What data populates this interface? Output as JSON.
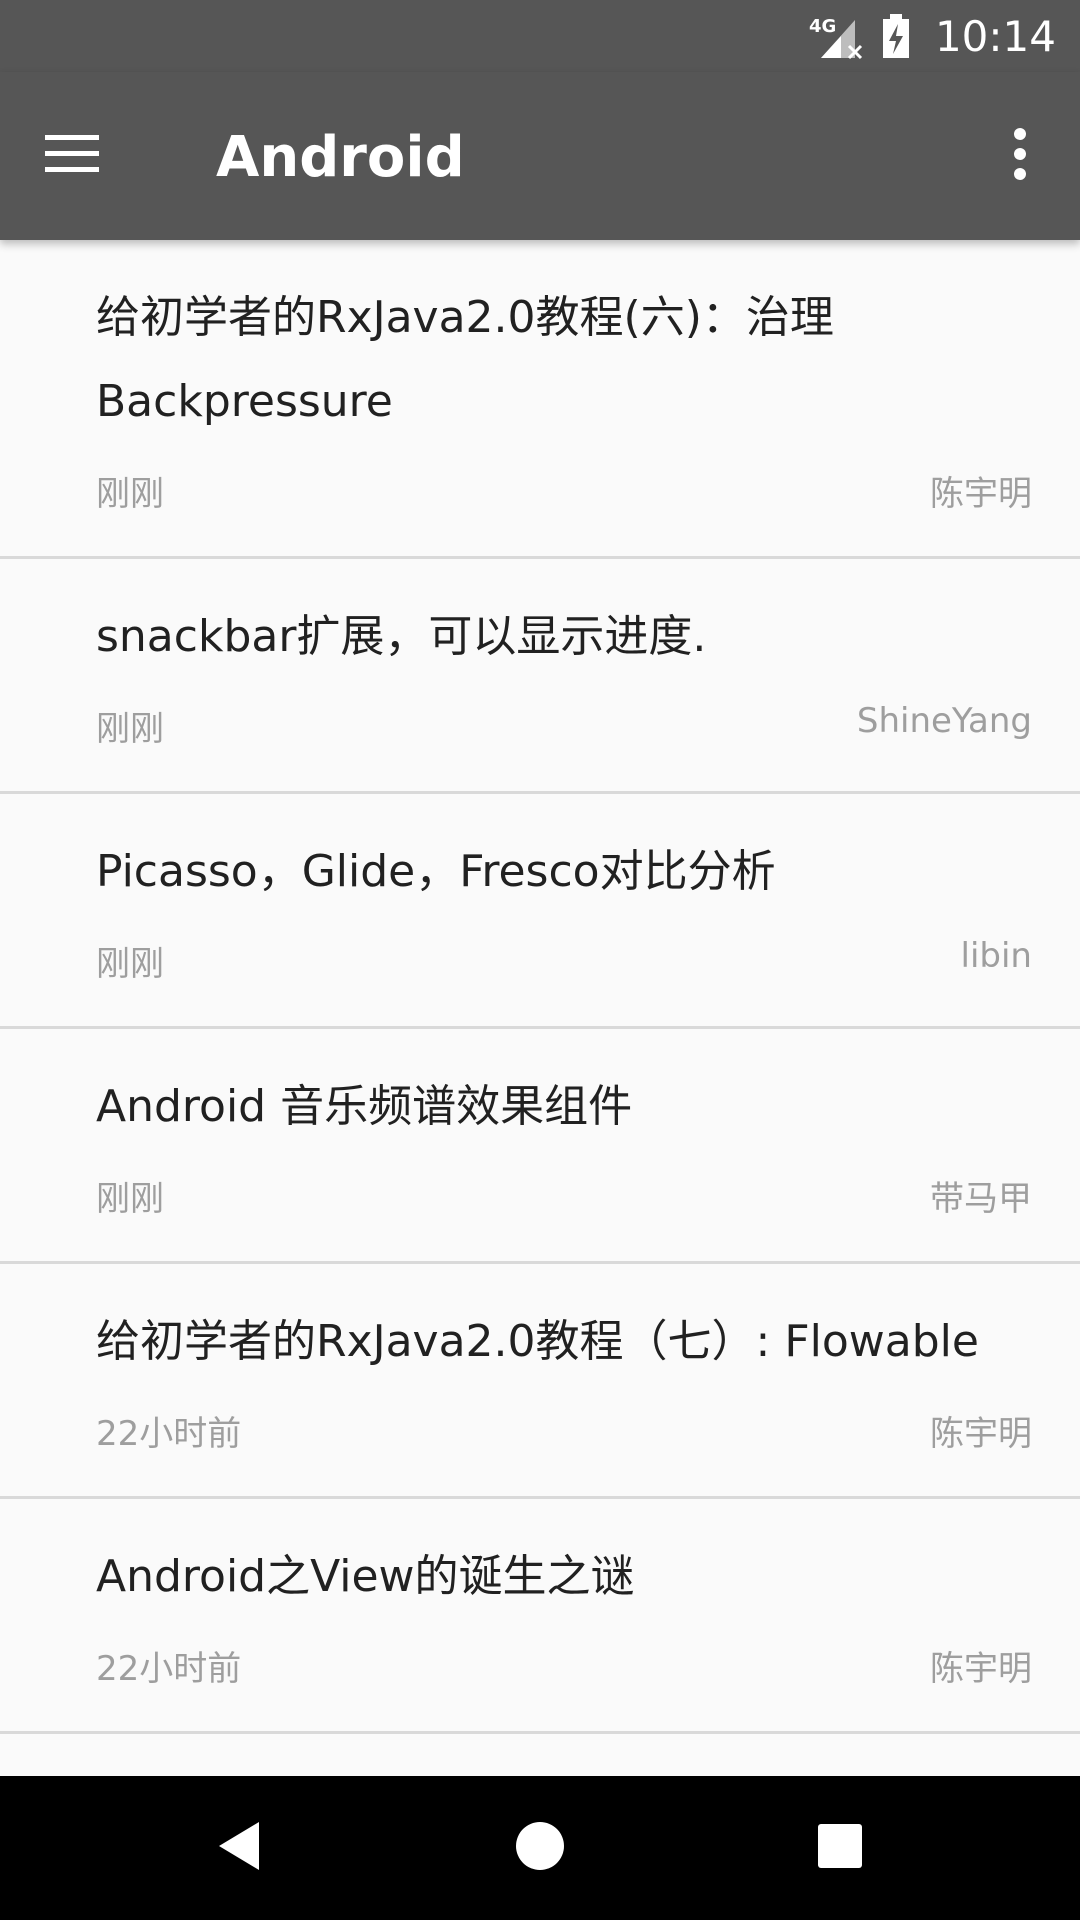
{
  "status_bar": {
    "network": "4G",
    "time": "10:14"
  },
  "app_bar": {
    "title": "Android"
  },
  "articles": [
    {
      "title": "给初学者的RxJava2.0教程(六)：治理Backpressure",
      "time": "刚刚",
      "author": "陈宇明"
    },
    {
      "title": "snackbar扩展，可以显示进度.",
      "time": "刚刚",
      "author": "ShineYang"
    },
    {
      "title": "Picasso，Glide，Fresco对比分析",
      "time": "刚刚",
      "author": "libin"
    },
    {
      "title": "Android 音乐频谱效果组件",
      "time": "刚刚",
      "author": "带马甲"
    },
    {
      "title": "给初学者的RxJava2.0教程（七）: Flowable",
      "time": "22小时前",
      "author": "陈宇明"
    },
    {
      "title": "Android之View的诞生之谜",
      "time": "22小时前",
      "author": "陈宇明"
    }
  ],
  "colors": {
    "app_bar": "#565656",
    "background": "#fafafa",
    "title_text": "#212121",
    "meta_text": "#9e9e9e",
    "divider": "#d9d9d9",
    "nav_bar": "#000000"
  },
  "icons": {
    "menu": "hamburger-menu-icon",
    "overflow": "more-vert-icon",
    "signal": "signal-4g-icon",
    "battery": "battery-charging-icon",
    "back": "back-triangle-icon",
    "home": "home-circle-icon",
    "recents": "recents-square-icon"
  }
}
